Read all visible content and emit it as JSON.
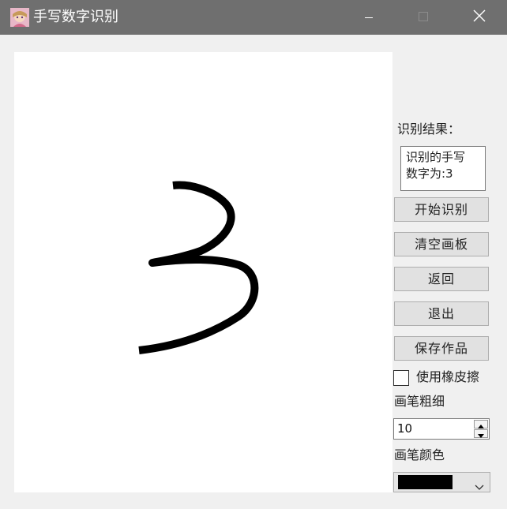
{
  "window": {
    "title": "手写数字识别",
    "icon": "app-avatar-icon",
    "controls": [
      "minimize-icon",
      "maximize-icon",
      "close-icon"
    ]
  },
  "canvas": {
    "drawn_digit": "3",
    "stroke_color": "#000000",
    "background": "#ffffff"
  },
  "result": {
    "label": "识别结果：",
    "text_line1": "识别的手写",
    "text_line2": "数字为:3"
  },
  "buttons": {
    "start": "开始识别",
    "clear": "清空画板",
    "back": "返回",
    "exit": "退出",
    "save": "保存作品"
  },
  "eraser": {
    "label": "使用橡皮擦",
    "checked": false
  },
  "pen": {
    "thickness_label": "画笔粗细",
    "thickness_value": "10",
    "color_label": "画笔颜色",
    "color_value": "#000000"
  },
  "colors": {
    "titlebar": "#6f6f6f",
    "window_bg": "#f0f0f0",
    "button_bg": "#e1e1e1"
  }
}
